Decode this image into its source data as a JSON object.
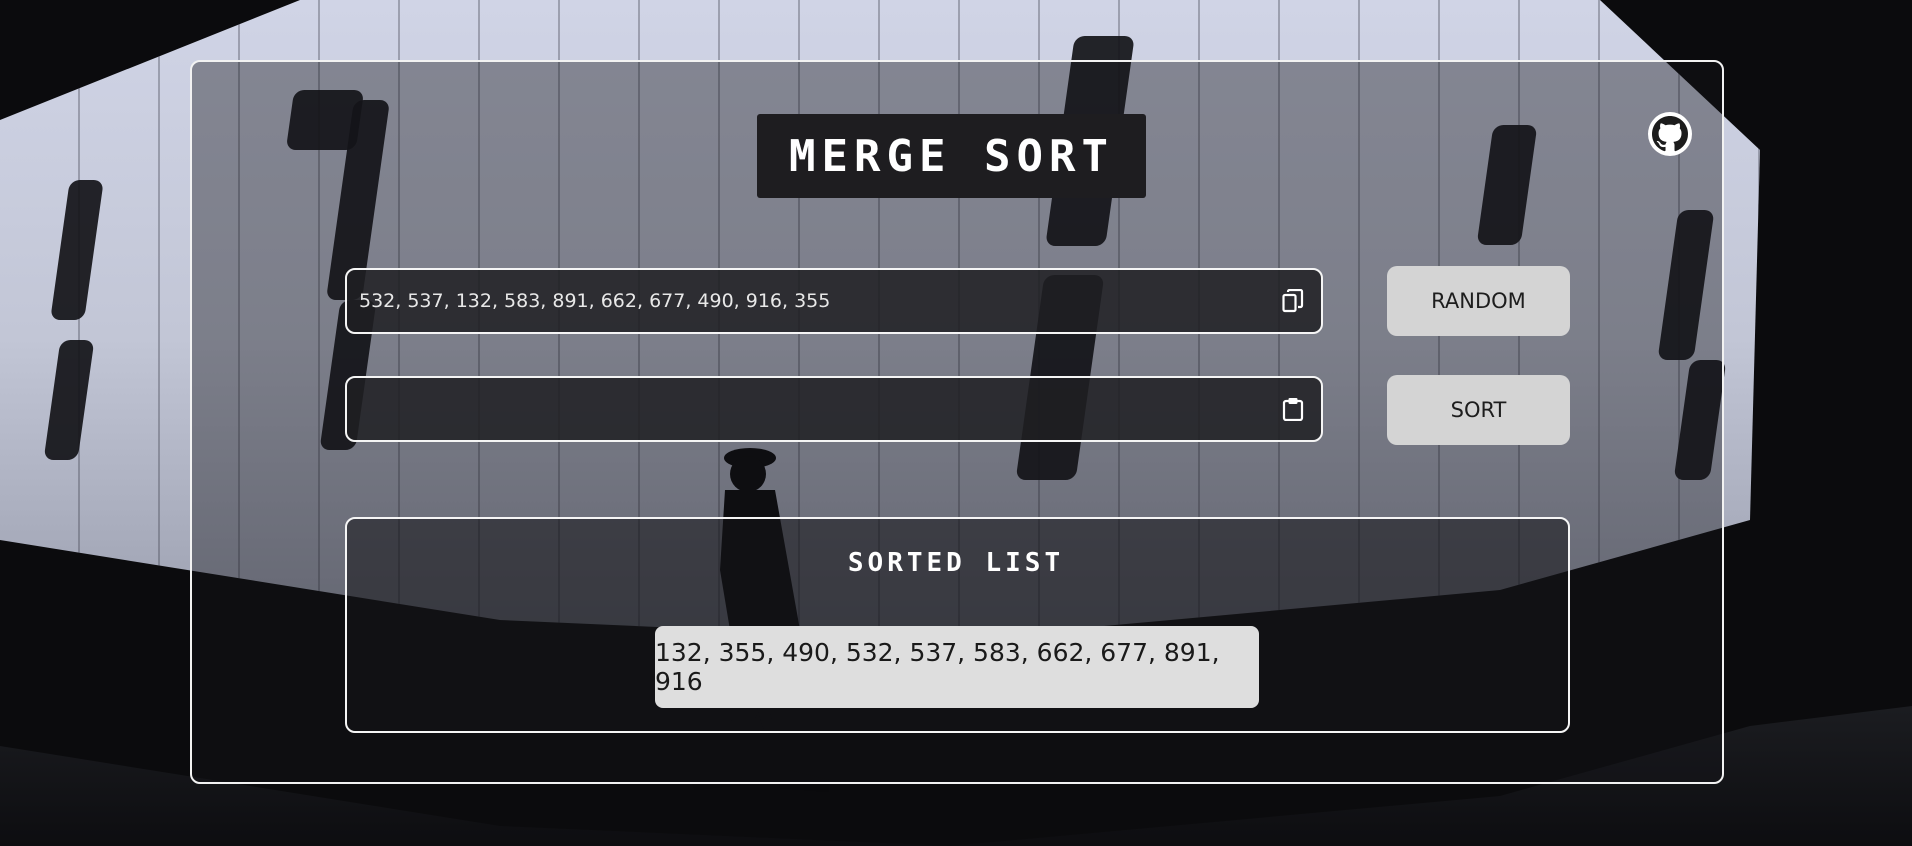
{
  "header": {
    "title": "MERGE SORT"
  },
  "github": {
    "icon": "github-icon"
  },
  "input": {
    "value": "532, 537, 132, 583, 891, 662, 677, 490, 916, 355",
    "icon": "copy-icon"
  },
  "output": {
    "value": "",
    "icon": "clipboard-icon"
  },
  "buttons": {
    "random": "RANDOM",
    "sort": "SORT"
  },
  "result": {
    "title": "SORTED LIST",
    "value": "132, 355, 490, 532, 537, 583, 662, 677, 891, 916"
  },
  "colors": {
    "card_border": "#f2f2f2",
    "title_bg": "#1e1d20",
    "button_bg": "#d4d4d4",
    "pill_bg": "#dedede"
  }
}
